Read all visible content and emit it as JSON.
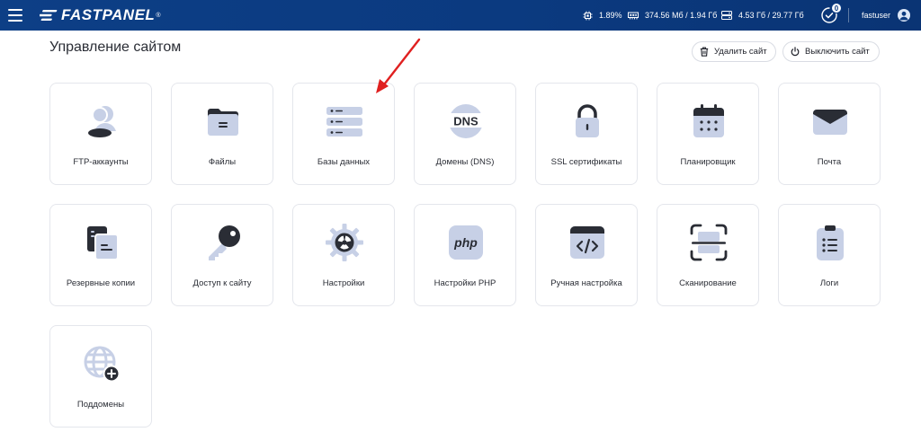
{
  "topbar": {
    "logo_text": "FASTPANEL",
    "logo_reg": "®",
    "cpu": "1.89%",
    "ram": "374.56 Мб / 1.94 Гб",
    "disk": "4.53 Гб / 29.77 Гб",
    "tasks_count": "0",
    "username": "fastuser"
  },
  "page": {
    "title": "Управление сайтом",
    "delete_label": "Удалить сайт",
    "disable_label": "Выключить сайт"
  },
  "tiles": [
    {
      "label": "FTP-аккаунты",
      "icon": "users-icon"
    },
    {
      "label": "Файлы",
      "icon": "folder-icon"
    },
    {
      "label": "Базы данных",
      "icon": "database-icon"
    },
    {
      "label": "Домены (DNS)",
      "icon": "dns-icon"
    },
    {
      "label": "SSL сертификаты",
      "icon": "lock-icon"
    },
    {
      "label": "Планировщик",
      "icon": "calendar-icon"
    },
    {
      "label": "Почта",
      "icon": "envelope-icon"
    },
    {
      "label": "Резервные копии",
      "icon": "backup-icon"
    },
    {
      "label": "Доступ к сайту",
      "icon": "key-icon"
    },
    {
      "label": "Настройки",
      "icon": "gear-icon"
    },
    {
      "label": "Настройки PHP",
      "icon": "php-icon"
    },
    {
      "label": "Ручная настройка",
      "icon": "code-icon"
    },
    {
      "label": "Сканирование",
      "icon": "scan-icon"
    },
    {
      "label": "Логи",
      "icon": "clipboard-icon"
    },
    {
      "label": "Поддомены",
      "icon": "globe-plus-icon"
    }
  ],
  "colors": {
    "header": "#0b3a80",
    "icon_fill": "#c7d0e6",
    "icon_dark": "#2a2d35",
    "arrow": "#e02020"
  }
}
